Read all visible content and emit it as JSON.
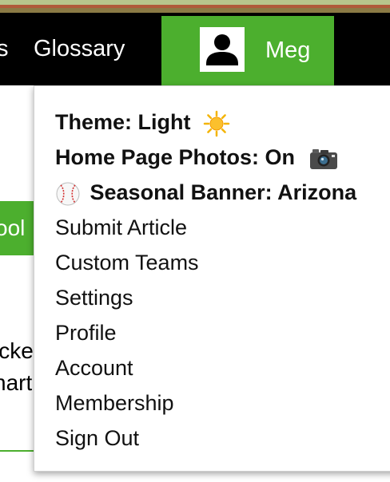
{
  "nav": {
    "prev_partial": "ts",
    "glossary": "Glossary",
    "user_name": "Meg"
  },
  "background": {
    "green_button_partial": "ool",
    "text_line_1": "icke",
    "text_line_2": "nart"
  },
  "menu": {
    "theme": "Theme: Light",
    "photos": "Home Page Photos: On",
    "banner": "Seasonal Banner: Arizona",
    "submit": "Submit Article",
    "teams": "Custom Teams",
    "settings": "Settings",
    "profile": "Profile",
    "account": "Account",
    "membership": "Membership",
    "signout": "Sign Out"
  },
  "icons": {
    "theme": "sun-icon",
    "photos": "camera-icon",
    "banner": "baseball-icon",
    "user": "user-icon"
  },
  "colors": {
    "accent_green": "#4caf2e",
    "navbar": "#000000"
  }
}
